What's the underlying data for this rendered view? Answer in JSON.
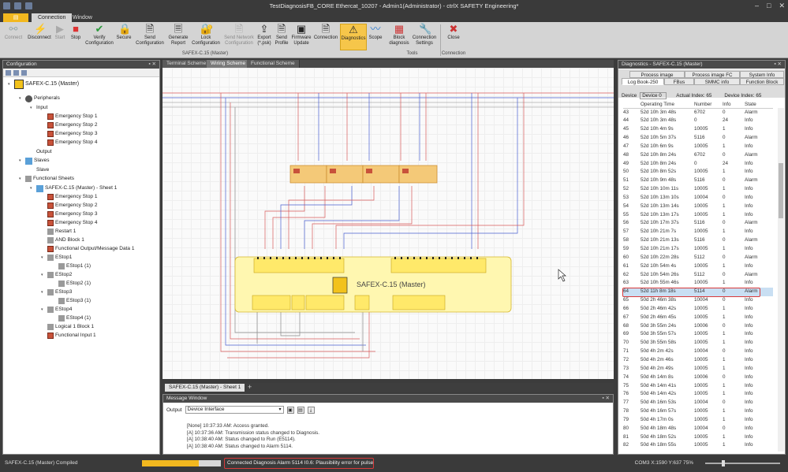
{
  "window": {
    "title": "TestDiagnosisFB_CORE Ethercat_10207 - Admin1(Administrator) - ctrlX SAFETY Engineering*"
  },
  "ribbon_tabs": {
    "file_label": "",
    "connection": "Connection",
    "window": "Window"
  },
  "ribbon": {
    "connect": "Connect",
    "disconnect": "Disconnect",
    "start": "Start",
    "stop": "Stop",
    "verify": "Verify Configuration",
    "secure": "Secure",
    "send_config": "Send Configuration",
    "generate_report": "Generate Report",
    "lock_config": "Lock Configuration",
    "send_network": "Send Network Configuration",
    "export": "Export (*.psk)",
    "send_profile": "Send Profile",
    "firmware_update": "Firmware Update",
    "connection": "Connection",
    "diagnostics": "Diagnostics",
    "scope": "Scope",
    "block_diagnosis": "Block diagnosis",
    "connection_settings": "Connection Settings",
    "close": "Close",
    "group_device": "SAFEX-C.15 (Master)",
    "group_tools": "Tools",
    "group_connection": "Connection"
  },
  "config_panel": {
    "title": "Configuration",
    "tree": [
      "SAFEX-C.15 (Master)",
      "Peripherals",
      "Input",
      "Emergency Stop 1",
      "Emergency Stop 2",
      "Emergency Stop 3",
      "Emergency Stop 4",
      "Output",
      "Slaves",
      "Slave",
      "Functional Sheets",
      "SAFEX-C.15 (Master) - Sheet 1",
      "Emergency Stop 1",
      "Emergency Stop 2",
      "Emergency Stop 3",
      "Emergency Stop 4",
      "Restart 1",
      "AND Block 1",
      "Functional Output/Message Data 1",
      "EStop1",
      "EStop1 (1)",
      "EStop2",
      "EStop2 (1)",
      "EStop3",
      "EStop3 (1)",
      "EStop4",
      "EStop4 (1)",
      "Logical 1 Block 1",
      "Functional Input 1"
    ]
  },
  "doc_tabs": [
    "Terminal Scheme",
    "Wiring Scheme",
    "Functional Scheme"
  ],
  "scheme": {
    "device_label": "SAFEX-C.15 (Master)"
  },
  "sheet_tab": "SAFEX-C.15 (Master) - Sheet 1",
  "message_window": {
    "title": "Message Window",
    "output_label": "Output",
    "output_value": "Device Interface",
    "lines": [
      "[None] 10:37:33 AM:   Access granted.",
      "[A] 10:37:36 AM:   Transmission status changed to Diagnosis.",
      "[A] 10:38:40 AM:   Status changed to Run (E5114).",
      "[A] 10:38:40 AM:   Status changed to Alarm 5114."
    ]
  },
  "diagnostics": {
    "title": "Diagnostics - SAFEX-C.15 (Master)",
    "tabs_row1": [
      "Process image",
      "Process image FC",
      "System Info"
    ],
    "tabs_row2": [
      "Log Book-250",
      "FBus",
      "SMMC info",
      "Function Block"
    ],
    "device_label": "Device",
    "device_value": "Device 0",
    "actual_index": "Actual Index: 65",
    "device_index": "Device Index: 65",
    "columns": [
      "",
      "Operating Time",
      "Number",
      "Info",
      "State"
    ],
    "rows": [
      [
        "43",
        "52d 10h 3m 48s",
        "6702",
        "0",
        "Alarm"
      ],
      [
        "44",
        "52d 10h 3m 48s",
        "0",
        "24",
        "Info"
      ],
      [
        "45",
        "52d 10h 4m 9s",
        "10005",
        "1",
        "Info"
      ],
      [
        "46",
        "52d 10h 5m 37s",
        "5116",
        "0",
        "Alarm"
      ],
      [
        "47",
        "52d 10h 6m 9s",
        "10005",
        "1",
        "Info"
      ],
      [
        "48",
        "52d 10h 8m 24s",
        "6702",
        "0",
        "Alarm"
      ],
      [
        "49",
        "52d 10h 8m 24s",
        "0",
        "24",
        "Info"
      ],
      [
        "50",
        "52d 10h 8m 52s",
        "10005",
        "1",
        "Info"
      ],
      [
        "51",
        "52d 10h 9m 48s",
        "5116",
        "0",
        "Alarm"
      ],
      [
        "52",
        "52d 10h 10m 11s",
        "10005",
        "1",
        "Info"
      ],
      [
        "53",
        "52d 10h 13m 10s",
        "10004",
        "0",
        "Info"
      ],
      [
        "54",
        "52d 10h 13m 14s",
        "10005",
        "1",
        "Info"
      ],
      [
        "55",
        "52d 10h 13m 17s",
        "10005",
        "1",
        "Info"
      ],
      [
        "56",
        "52d 10h 17m 37s",
        "5116",
        "0",
        "Alarm"
      ],
      [
        "57",
        "52d 10h 21m 7s",
        "10005",
        "1",
        "Info"
      ],
      [
        "58",
        "52d 10h 21m 13s",
        "5116",
        "0",
        "Alarm"
      ],
      [
        "59",
        "52d 10h 21m 17s",
        "10005",
        "1",
        "Info"
      ],
      [
        "60",
        "52d 10h 22m 28s",
        "5112",
        "0",
        "Alarm"
      ],
      [
        "61",
        "52d 10h 54m 4s",
        "10005",
        "1",
        "Info"
      ],
      [
        "62",
        "52d 10h 54m 26s",
        "5112",
        "0",
        "Alarm"
      ],
      [
        "63",
        "52d 10h 55m 46s",
        "10005",
        "1",
        "Info"
      ],
      [
        "64",
        "52d 11h 8m 18s",
        "5114",
        "0",
        "Alarm"
      ],
      [
        "65",
        "50d 2h 46m 38s",
        "10004",
        "0",
        "Info"
      ],
      [
        "66",
        "50d 2h 46m 42s",
        "10005",
        "1",
        "Info"
      ],
      [
        "67",
        "50d 2h 46m 45s",
        "10005",
        "1",
        "Info"
      ],
      [
        "68",
        "50d 3h 55m 24s",
        "10006",
        "0",
        "Info"
      ],
      [
        "69",
        "50d 3h 55m 57s",
        "10005",
        "1",
        "Info"
      ],
      [
        "70",
        "50d 3h 55m 58s",
        "10005",
        "1",
        "Info"
      ],
      [
        "71",
        "50d 4h 2m 42s",
        "10004",
        "0",
        "Info"
      ],
      [
        "72",
        "50d 4h 2m 46s",
        "10005",
        "1",
        "Info"
      ],
      [
        "73",
        "50d 4h 2m 49s",
        "10005",
        "1",
        "Info"
      ],
      [
        "74",
        "50d 4h 14m 8s",
        "10006",
        "0",
        "Info"
      ],
      [
        "75",
        "50d 4h 14m 41s",
        "10005",
        "1",
        "Info"
      ],
      [
        "76",
        "50d 4h 14m 42s",
        "10005",
        "1",
        "Info"
      ],
      [
        "77",
        "50d 4h 16m 53s",
        "10004",
        "0",
        "Info"
      ],
      [
        "78",
        "50d 4h 16m 57s",
        "10005",
        "1",
        "Info"
      ],
      [
        "79",
        "50d 4h 17m 0s",
        "10005",
        "1",
        "Info"
      ],
      [
        "80",
        "50d 4h 18m 48s",
        "10004",
        "0",
        "Info"
      ],
      [
        "81",
        "50d 4h 18m 52s",
        "10005",
        "1",
        "Info"
      ],
      [
        "82",
        "50d 4h 18m 55s",
        "10005",
        "1",
        "Info"
      ]
    ],
    "highlighted_row": 21
  },
  "statusbar": {
    "device": "SAFEX-C.15 (Master)   Compiled",
    "progress_fraction": 0.72,
    "message": "Connected   Diagnosis   Alarm 5114   I0.6: Plausibility error for pulse",
    "port": "COM3   X:1590 Y:637   75%",
    "zoom_fraction": 0.22
  },
  "colors": {
    "accent": "#f2b81f",
    "highlight_border": "#d93a3a",
    "module_fill": "#fff7b0",
    "wire_red": "#e05858",
    "wire_blue": "#4a5fd0"
  }
}
